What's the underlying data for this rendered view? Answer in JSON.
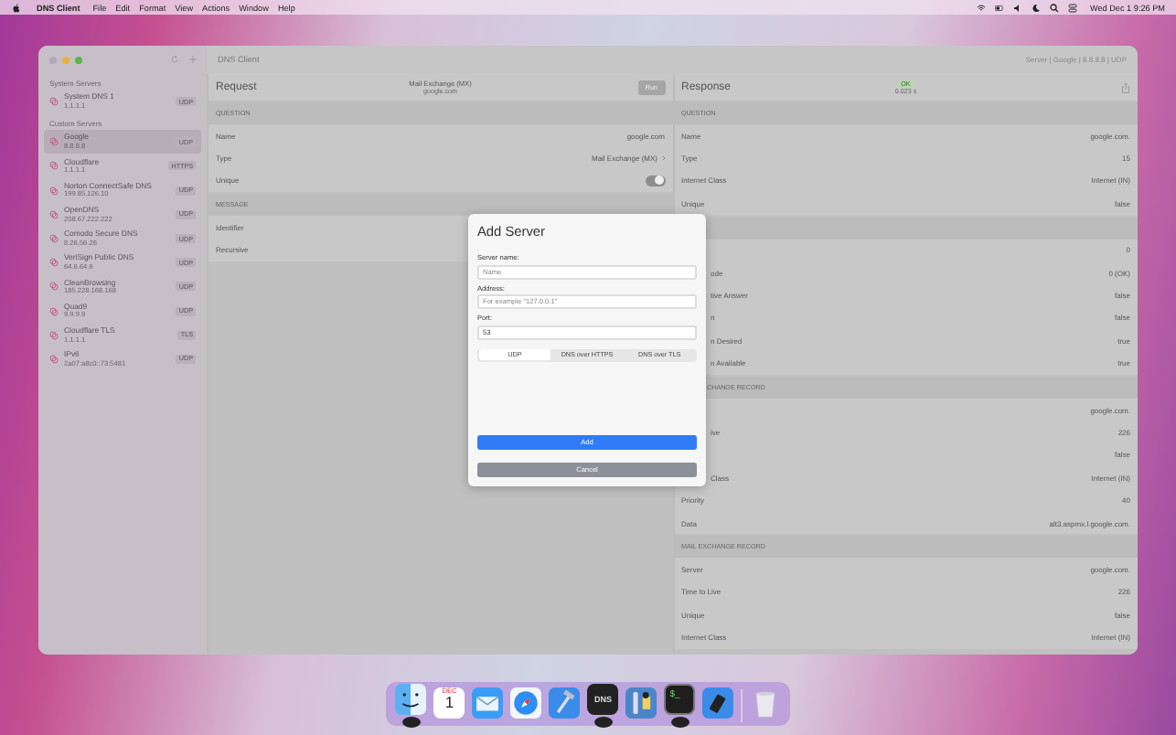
{
  "menu_bar": {
    "app": "DNS Client",
    "menus": [
      "File",
      "Edit",
      "Format",
      "View",
      "Actions",
      "Window",
      "Help"
    ],
    "clock": "Wed Dec 1  9:26 PM"
  },
  "window": {
    "title": "DNS Client",
    "server_info": "Server | Google | 8.8.8.8 | UDP"
  },
  "sidebar": {
    "sections": [
      {
        "title": "System Servers",
        "items": [
          {
            "name": "System DNS 1",
            "address": "1.1.1.1",
            "protocol": "UDP",
            "selected": false
          }
        ]
      },
      {
        "title": "Custom Servers",
        "items": [
          {
            "name": "Google",
            "address": "8.8.8.8",
            "protocol": "UDP",
            "selected": true
          },
          {
            "name": "Cloudflare",
            "address": "1.1.1.1",
            "protocol": "HTTPS",
            "selected": false
          },
          {
            "name": "Norton ConnectSafe DNS",
            "address": "199.85.126.10",
            "protocol": "UDP",
            "selected": false
          },
          {
            "name": "OpenDNS",
            "address": "208.67.222.222",
            "protocol": "UDP",
            "selected": false
          },
          {
            "name": "Comodo Secure DNS",
            "address": "8.26.56.26",
            "protocol": "UDP",
            "selected": false
          },
          {
            "name": "VeriSign Public DNS",
            "address": "64.6.64.6",
            "protocol": "UDP",
            "selected": false
          },
          {
            "name": "CleanBrowsing",
            "address": "185.228.168.168",
            "protocol": "UDP",
            "selected": false
          },
          {
            "name": "Quad9",
            "address": "9.9.9.9",
            "protocol": "UDP",
            "selected": false
          },
          {
            "name": "Cloudflare TLS",
            "address": "1.1.1.1",
            "protocol": "TLS",
            "selected": false
          },
          {
            "name": "IPv6",
            "address": "2a07:a8c0::73:5481",
            "protocol": "UDP",
            "selected": false
          }
        ]
      }
    ]
  },
  "request": {
    "title": "Request",
    "query_type": "Mail Exchange (MX)",
    "query_name": "google.com",
    "run_button": "Run",
    "sections": [
      {
        "title": "QUESTION",
        "rows": [
          {
            "kind": "text",
            "label": "Name",
            "value": "google.com"
          },
          {
            "kind": "picker",
            "label": "Type",
            "value": "Mail Exchange (MX)"
          },
          {
            "kind": "toggle",
            "label": "Unique",
            "on": true
          }
        ]
      },
      {
        "title": "MESSAGE",
        "rows": [
          {
            "kind": "text",
            "label": "Identifier"
          },
          {
            "kind": "text",
            "label": "Recursive"
          }
        ]
      }
    ]
  },
  "response": {
    "title": "Response",
    "status": "OK",
    "time": "0.023 s",
    "sections": [
      {
        "title": "QUESTION",
        "kind": "full",
        "rows": [
          {
            "kind": "full",
            "label": "Name",
            "value": "google.com."
          },
          {
            "kind": "full",
            "label": "Type",
            "value": "15"
          },
          {
            "kind": "full",
            "label": "Internet Class",
            "value": "Internet (IN)"
          },
          {
            "kind": "full",
            "label": "Unique",
            "value": "false"
          }
        ]
      },
      {
        "kind": "partial",
        "rows": [
          {
            "kind": "partial",
            "value": "0"
          },
          {
            "kind": "partial",
            "label": "ode",
            "value": "0 (OK)"
          },
          {
            "kind": "partial",
            "label": "tive Answer",
            "value": "false"
          },
          {
            "kind": "partial",
            "label": "n",
            "value": "false"
          },
          {
            "kind": "partial",
            "label": "n Desired",
            "value": "true"
          },
          {
            "kind": "partial",
            "label": "n Available",
            "value": "true"
          }
        ]
      },
      {
        "title": "CHANGE RECORD",
        "kind": "partial",
        "rows": [
          {
            "kind": "partial",
            "value": "google.com."
          },
          {
            "kind": "partial",
            "label": "ive",
            "value": "226"
          },
          {
            "kind": "partial",
            "value": "false"
          },
          {
            "kind": "partial",
            "label": "Class",
            "value": "Internet (IN)"
          },
          {
            "kind": "full",
            "label": "Priority",
            "value": "40"
          },
          {
            "kind": "full",
            "label": "Data",
            "value": "alt3.aspmx.l.google.com."
          }
        ]
      },
      {
        "title": "MAIL EXCHANGE RECORD",
        "kind": "full",
        "rows": [
          {
            "kind": "full",
            "label": "Server",
            "value": "google.com."
          },
          {
            "kind": "full",
            "label": "Time to Live",
            "value": "226"
          },
          {
            "kind": "full",
            "label": "Unique",
            "value": "false"
          },
          {
            "kind": "full",
            "label": "Internet Class",
            "value": "Internet (IN)"
          }
        ]
      }
    ]
  },
  "dialog": {
    "title": "Add Server",
    "fields": [
      {
        "label": "Server name:",
        "placeholder": "Name"
      },
      {
        "label": "Address:",
        "placeholder": "For example \"127.0.0.1\""
      },
      {
        "label": "Port:",
        "value": "53"
      }
    ],
    "protocols": [
      {
        "label": "UDP",
        "selected": true
      },
      {
        "label": "DNS over HTTPS",
        "selected": false
      },
      {
        "label": "DNS over TLS",
        "selected": false
      }
    ],
    "add_button": "Add",
    "cancel_button": "Cancel"
  },
  "dock": [
    {
      "kind": "finder",
      "running": true
    },
    {
      "kind": "calendar",
      "month": "DEC",
      "day": "1",
      "running": false
    },
    {
      "kind": "mail",
      "running": false
    },
    {
      "kind": "safari",
      "running": false
    },
    {
      "kind": "xcode",
      "running": false
    },
    {
      "kind": "dns",
      "label": "DNS",
      "running": true
    },
    {
      "kind": "instruments",
      "running": false
    },
    {
      "kind": "terminal",
      "label": "$_",
      "running": true
    },
    {
      "kind": "utility",
      "running": false
    },
    {
      "kind": "trash",
      "running": false
    }
  ]
}
